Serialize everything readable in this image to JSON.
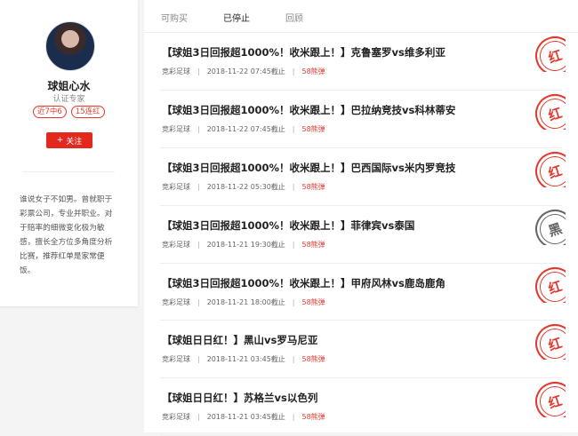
{
  "profile": {
    "name": "球姐心水",
    "title": "认证专家",
    "tags": [
      "近7中6",
      "15连红"
    ],
    "follow_label": "关注",
    "bio": "谁说女子不如男。曾就职于彩票公司，专业并职业。对于赔率的细微变化极为敏感，擅长全方位多角度分析比赛，推荐红单是家常便饭。"
  },
  "tabs": [
    "可购买",
    "已停止",
    "回顾"
  ],
  "active_tab": "已停止",
  "items": [
    {
      "title": "【球姐3日回报超1000%！收米跟上！】克鲁塞罗vs维多利亚",
      "category": "竞彩足球",
      "time": "2018-11-22 07:45截止",
      "price": "58熊弹",
      "result": "红"
    },
    {
      "title": "【球姐3日回报超1000%！收米跟上！】巴拉纳竞技vs科林蒂安",
      "category": "竞彩足球",
      "time": "2018-11-22 07:45截止",
      "price": "58熊弹",
      "result": "红"
    },
    {
      "title": "【球姐3日回报超1000%！收米跟上！】巴西国际vs米内罗竞技",
      "category": "竞彩足球",
      "time": "2018-11-22 05:30截止",
      "price": "58熊弹",
      "result": "红"
    },
    {
      "title": "【球姐3日回报超1000%！收米跟上！】菲律宾vs泰国",
      "category": "竞彩足球",
      "time": "2018-11-21 19:30截止",
      "price": "58熊弹",
      "result": "黑"
    },
    {
      "title": "【球姐3日回报超1000%！收米跟上！】甲府风林vs鹿岛鹿角",
      "category": "竞彩足球",
      "time": "2018-11-21 18:00截止",
      "price": "58熊弹",
      "result": "红"
    },
    {
      "title": "【球姐日日红！】黑山vs罗马尼亚",
      "category": "竞彩足球",
      "time": "2018-11-21 03:45截止",
      "price": "58熊弹",
      "result": "红"
    },
    {
      "title": "【球姐日日红！】苏格兰vs以色列",
      "category": "竞彩足球",
      "time": "2018-11-21 03:45截止",
      "price": "58熊弹",
      "result": "红"
    }
  ],
  "colors": {
    "accent": "#e3281e",
    "win": "#e23a2e",
    "loss": "#666666"
  }
}
